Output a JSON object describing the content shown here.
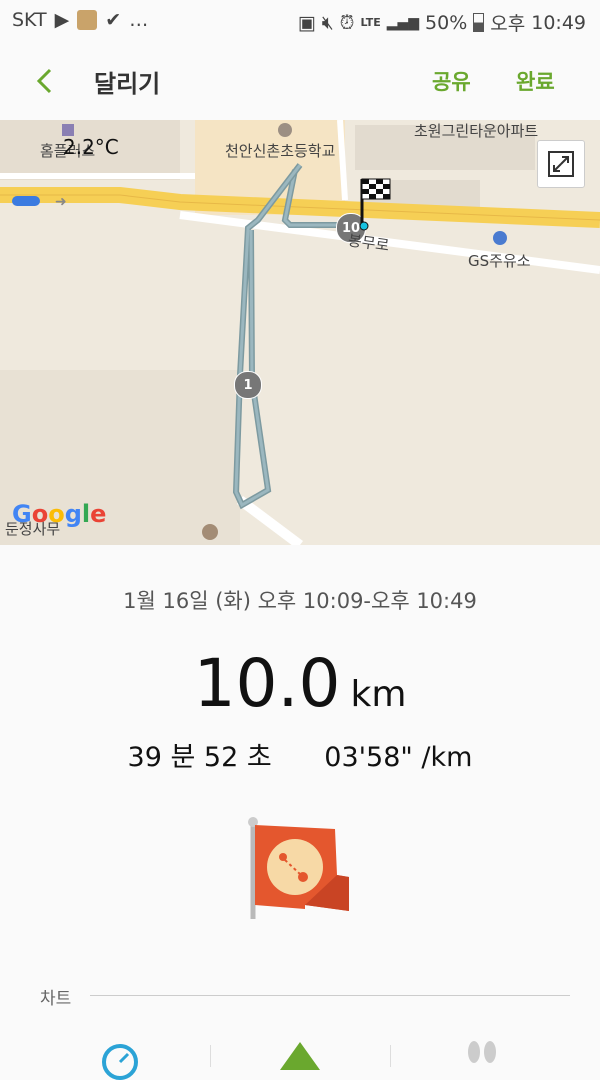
{
  "status": {
    "carrier": "SKT",
    "battery": "50%",
    "ampm": "오후",
    "time": "10:49",
    "network": "LTE"
  },
  "appbar": {
    "title": "달리기",
    "share_label": "공유",
    "done_label": "완료"
  },
  "map": {
    "temperature": "2.2°C",
    "labels": {
      "homeplus": "홈플러스",
      "school": "천안신촌초등학교",
      "apt": "초원그린타운아파트",
      "road": "봉무로",
      "gas": "GS주유소",
      "dunsan": "둔정사무"
    },
    "markers": {
      "km1": "1",
      "km10": "10"
    },
    "attribution": "Google"
  },
  "summary": {
    "date_range": "1월 16일 (화) 오후 10:09-오후 10:49",
    "distance": "10.0",
    "distance_unit": "km",
    "duration": "39 분 52 초",
    "pace": "03'58\" /km"
  },
  "chart_section": {
    "label": "차트"
  }
}
